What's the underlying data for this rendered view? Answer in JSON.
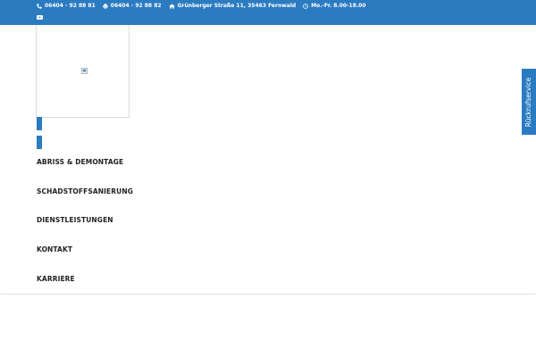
{
  "topbar": {
    "phone": "06404 - 92 88 81",
    "fax": "06404 - 92 88 82",
    "address": "Grünberger Straße 11, 35463 Fernwald",
    "hours": "Mo.-Fr. 8.00-18.00",
    "icons": {
      "phone": "phone-icon",
      "fax": "fax-icon",
      "address": "home-icon",
      "hours": "clock-icon",
      "social": "youtube-icon"
    }
  },
  "nav": {
    "items": [
      "ABRISS & DEMONTAGE",
      "SCHADSTOFFSANIERUNG",
      "DIENSTLEISTUNGEN",
      "KONTAKT",
      "KARRIERE"
    ]
  },
  "callback": {
    "label": "Rückrufservice"
  },
  "colors": {
    "brand": "#2b7bc1",
    "text": "#222222"
  }
}
